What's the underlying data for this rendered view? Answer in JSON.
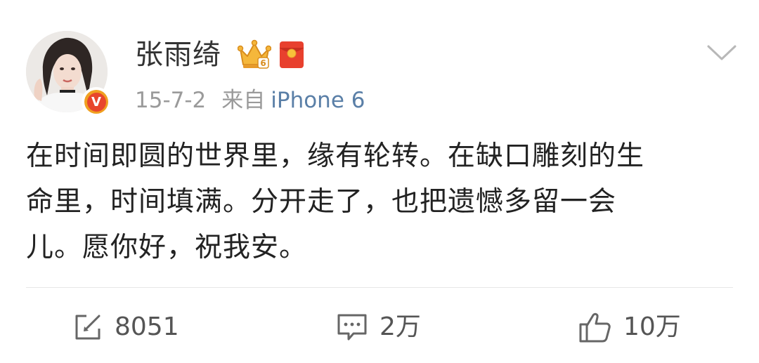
{
  "post": {
    "author": {
      "name": "张雨绮",
      "avatar_icon": "user-avatar-photo",
      "verified_icon": "verified-v-badge",
      "verified_mark": "V",
      "badges": [
        "crown-vip-icon",
        "red-packet-icon"
      ]
    },
    "meta": {
      "date": "15-7-2",
      "source_label": "来自",
      "device": "iPhone 6"
    },
    "content_lines": [
      "在时间即圆的世界里，缘有轮转。在缺口雕刻的生",
      "命里，时间填满。分开走了，也把遗憾多留一会",
      "儿。愿你好，祝我安。"
    ],
    "actions": {
      "repost": {
        "icon": "repost-icon",
        "count": "8051"
      },
      "comment": {
        "icon": "comment-icon",
        "count": "2万"
      },
      "like": {
        "icon": "thumbs-up-icon",
        "count": "10万"
      }
    },
    "menu_icon": "chevron-down-icon"
  },
  "colors": {
    "text_primary": "#333333",
    "text_meta": "#9a9a9a",
    "device_link": "#5a7fa7",
    "verified_orange": "#f0a020",
    "verified_red": "#e8462c",
    "crown_gold": "#f5b73b",
    "red_packet": "#e8402e"
  }
}
